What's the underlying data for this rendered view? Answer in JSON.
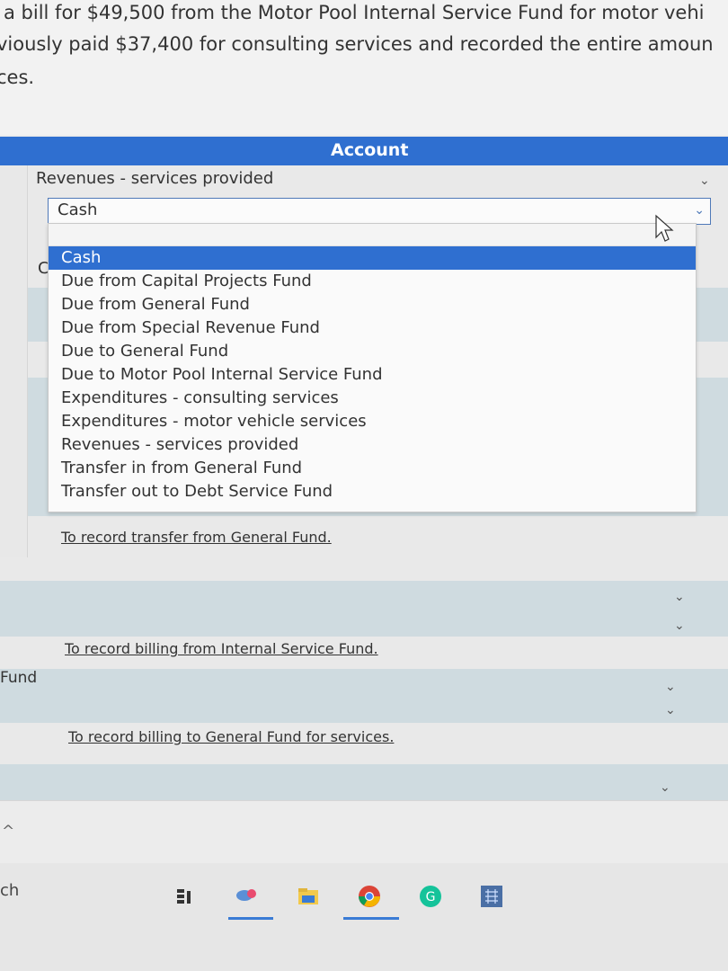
{
  "question": {
    "line1": "a bill for $49,500 from the Motor Pool Internal Service Fund for motor vehi",
    "line2": "viously paid $37,400 for consulting services and recorded the entire amoun",
    "line3": "ces."
  },
  "table": {
    "header": "Account",
    "row1_text": "Revenues - services provided",
    "select_value": "Cash",
    "partial_letter": "C"
  },
  "dropdown": {
    "options": [
      "Cash",
      "Due from Capital Projects Fund",
      "Due from General Fund",
      "Due from Special Revenue Fund",
      "Due to General Fund",
      "Due to Motor Pool Internal Service Fund",
      "Expenditures - consulting services",
      "Expenditures - motor vehicle services",
      "Revenues - services provided",
      "Transfer in from General Fund",
      "Transfer out to Debt Service Fund"
    ],
    "selected_index": 0
  },
  "memos": {
    "memo1": "To record transfer from General Fund.",
    "memo2": "To record billing from Internal Service Fund.",
    "memo3": "To record billing to General Fund for services."
  },
  "side_labels": {
    "fund": "Fund",
    "caret": "^",
    "ch": "ch"
  },
  "colors": {
    "header_blue": "#2f6fd0",
    "shaded_row": "#cfdbe0"
  },
  "taskbar": {
    "icons": [
      "task-view-icon",
      "paint-icon",
      "file-explorer-icon",
      "chrome-icon",
      "grammarly-icon",
      "snipping-icon"
    ]
  }
}
